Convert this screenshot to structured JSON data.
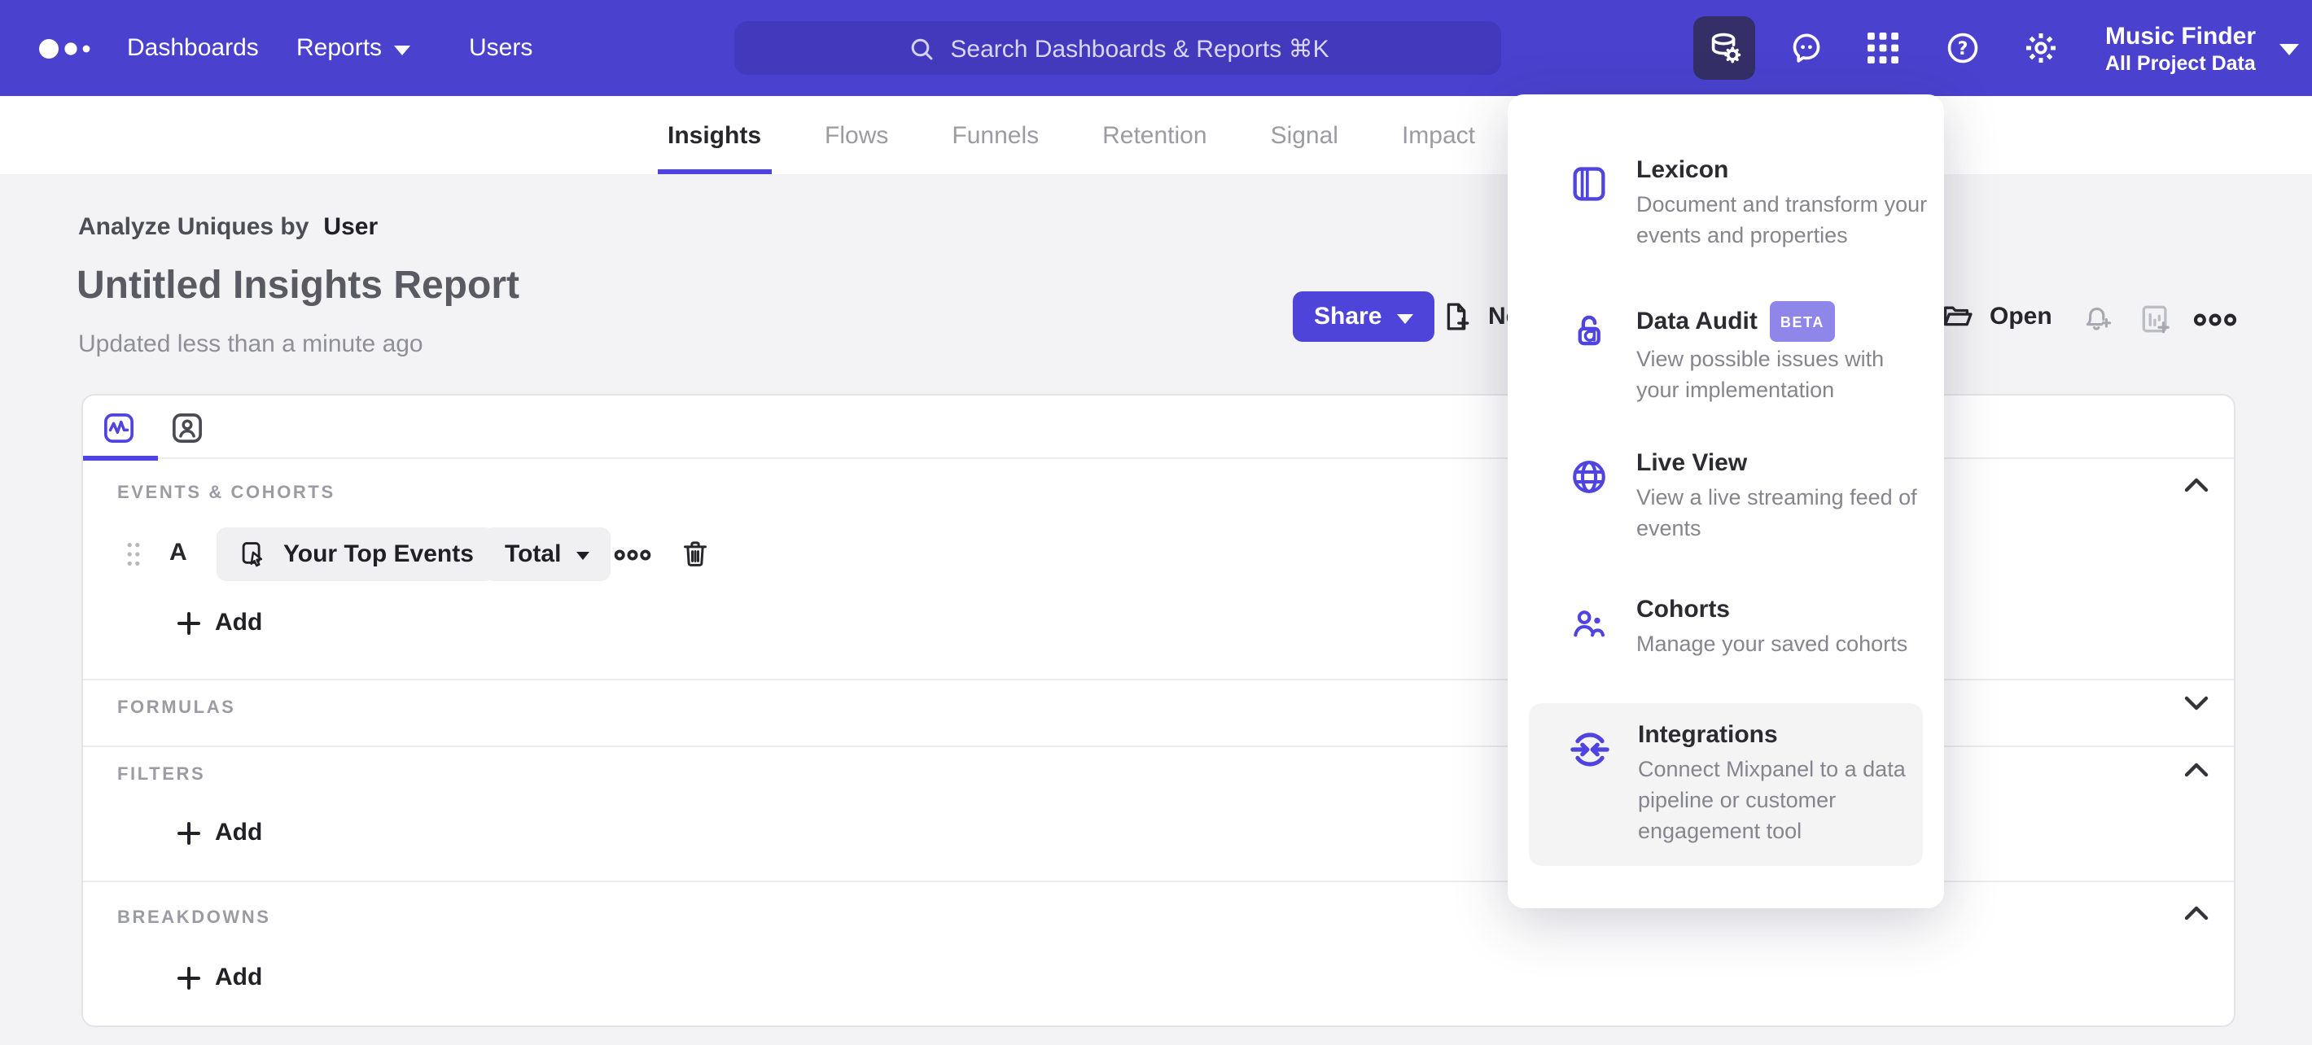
{
  "colors": {
    "navbar": "#4a42cf",
    "navbar_search": "#4339bc",
    "active_icon_bg": "#343067",
    "accent": "#4f44e0",
    "share_button": "#4f44da",
    "beta_badge": "#8f86ea",
    "page_bg": "#f3f3f5"
  },
  "topnav": {
    "items": [
      {
        "label": "Dashboards"
      },
      {
        "label": "Reports"
      },
      {
        "label": "Users"
      }
    ],
    "search_placeholder": "Search Dashboards & Reports ⌘K",
    "project": {
      "name": "Music Finder",
      "scope": "All Project Data"
    }
  },
  "tabs": [
    {
      "label": "Insights",
      "active": true
    },
    {
      "label": "Flows"
    },
    {
      "label": "Funnels"
    },
    {
      "label": "Retention"
    },
    {
      "label": "Signal"
    },
    {
      "label": "Impact"
    }
  ],
  "report": {
    "analyze_label": "Analyze Uniques by",
    "analyze_value": "User",
    "title": "Untitled Insights Report",
    "updated": "Updated less than a minute ago",
    "share_label": "Share",
    "new_label": "New",
    "open_label": "Open"
  },
  "builder": {
    "sections": [
      {
        "label": "EVENTS & COHORTS",
        "chevron": "up"
      },
      {
        "label": "FORMULAS",
        "chevron": "down"
      },
      {
        "label": "FILTERS",
        "chevron": "up"
      },
      {
        "label": "BREAKDOWNS",
        "chevron": "up"
      }
    ],
    "row": {
      "letter": "A",
      "event": "Your Top Events",
      "metric": "Total"
    },
    "add_label": "Add"
  },
  "menu": {
    "items": [
      {
        "title": "Lexicon",
        "desc": "Document and transform your events and properties"
      },
      {
        "title": "Data Audit",
        "badge": "BETA",
        "desc": "View possible issues with your implementation"
      },
      {
        "title": "Live View",
        "desc": "View a live streaming feed of events"
      },
      {
        "title": "Cohorts",
        "desc": "Manage your saved cohorts"
      },
      {
        "title": "Integrations",
        "desc": "Connect Mixpanel to a data pipeline or customer engagement tool",
        "highlighted": true
      }
    ]
  }
}
